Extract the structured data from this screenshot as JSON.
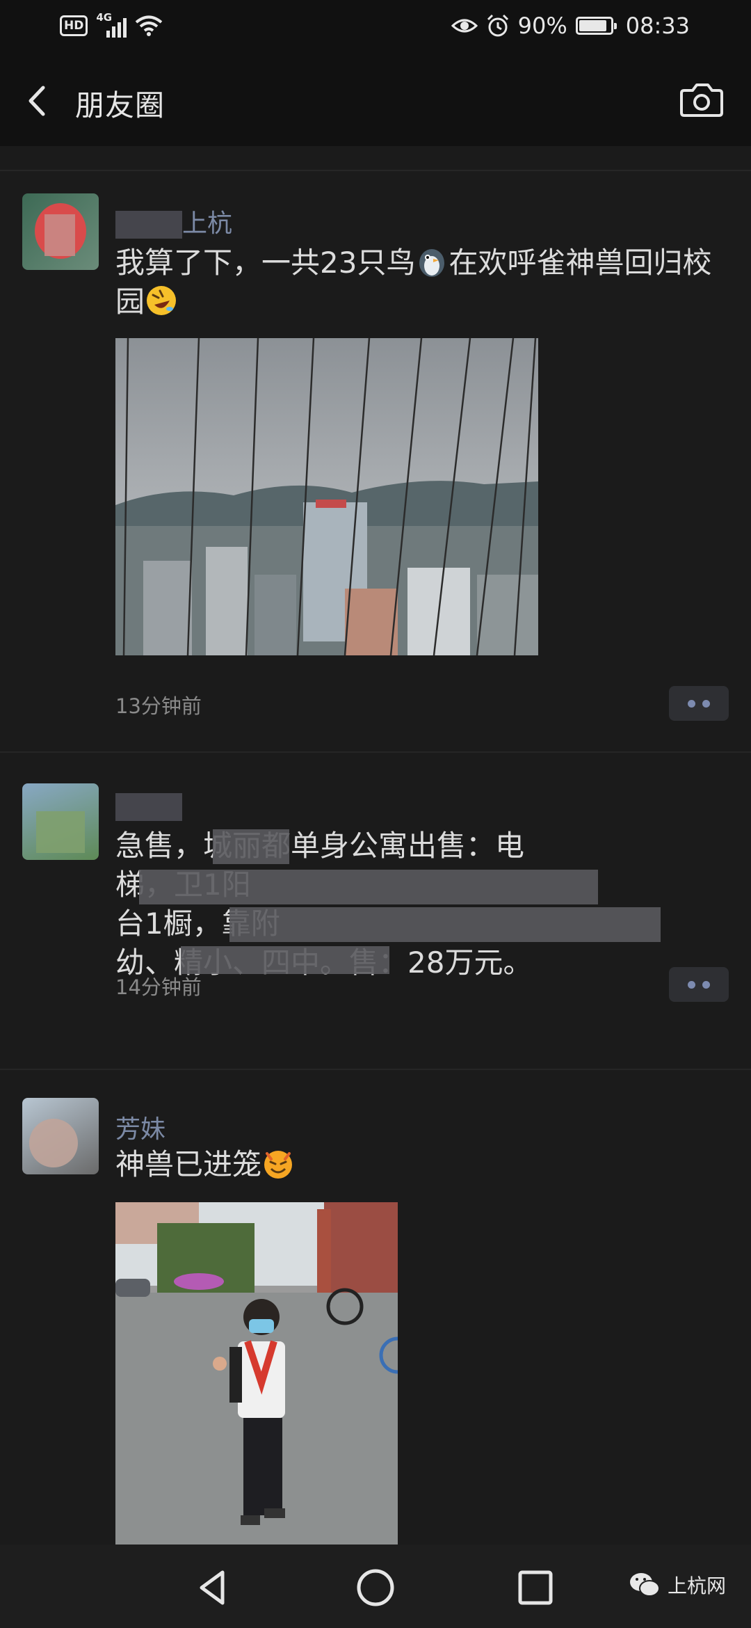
{
  "status_bar": {
    "hd": "HD",
    "network": "4G",
    "battery_percent": "90%",
    "battery_level": 0.9,
    "time": "08:33"
  },
  "header": {
    "title": "朋友圈",
    "back_icon": "chevron-left-icon",
    "camera_icon": "camera-icon"
  },
  "posts": [
    {
      "nickname": "上杭",
      "text_before": "我算了下，一共23只鸟",
      "text_after": "在欢呼雀神兽回归校园",
      "emojis": [
        "penguin-emoji",
        "rolling-laughing-emoji"
      ],
      "time": "13分钟前"
    },
    {
      "nickname": "",
      "text_line1": "急售，城丽都单身公寓出售：电",
      "text_line2": "梯，卫1阳",
      "text_line3": "台1橱，靠附",
      "text_line4": "幼、精小、四中。售：28万元。",
      "time": "14分钟前"
    },
    {
      "nickname": "芳妹",
      "text": "神兽已进笼",
      "emojis": [
        "smiling-devil-emoji"
      ]
    }
  ],
  "nav": {
    "back_icon": "triangle-back-icon",
    "home_icon": "circle-home-icon",
    "recents_icon": "square-recents-icon"
  },
  "watermark": {
    "text": "上杭网"
  },
  "colors": {
    "background": "#1b1b1b",
    "bar": "#111111",
    "nickname": "#7c8aa6",
    "text": "#dcdcdc",
    "time": "#8a8a8a"
  }
}
